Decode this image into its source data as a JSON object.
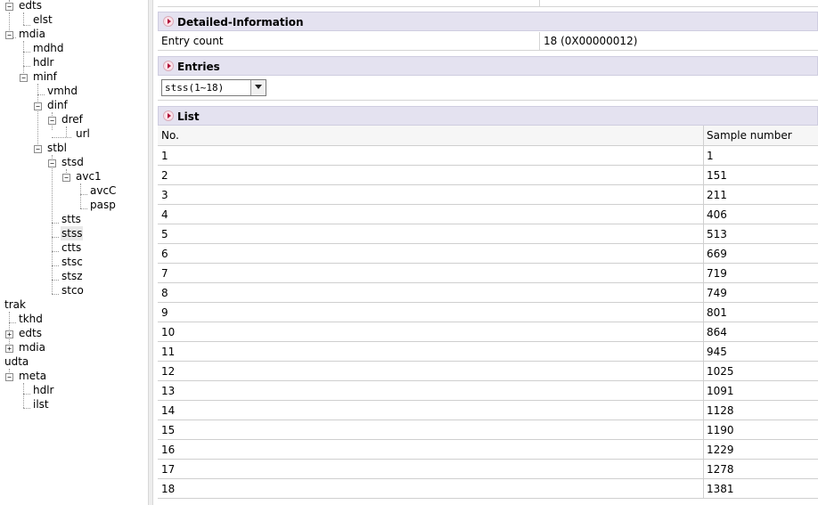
{
  "tree": {
    "nodes": [
      {
        "label": "edts"
      },
      {
        "label": "elst"
      },
      {
        "label": "mdia"
      },
      {
        "label": "mdhd"
      },
      {
        "label": "hdlr"
      },
      {
        "label": "minf"
      },
      {
        "label": "vmhd"
      },
      {
        "label": "dinf"
      },
      {
        "label": "dref"
      },
      {
        "label": "url"
      },
      {
        "label": "stbl"
      },
      {
        "label": "stsd"
      },
      {
        "label": "avc1"
      },
      {
        "label": "avcC"
      },
      {
        "label": "pasp"
      },
      {
        "label": "stts"
      },
      {
        "label": "stss"
      },
      {
        "label": "ctts"
      },
      {
        "label": "stsc"
      },
      {
        "label": "stsz"
      },
      {
        "label": "stco"
      },
      {
        "label": "trak"
      },
      {
        "label": "tkhd"
      },
      {
        "label": "edts"
      },
      {
        "label": "mdia"
      },
      {
        "label": "udta"
      },
      {
        "label": "meta"
      },
      {
        "label": "hdlr"
      },
      {
        "label": "ilst"
      }
    ],
    "expand_symbol": "+",
    "collapse_symbol": "−",
    "selected": "stss"
  },
  "panel": {
    "detailed_title": "Detailed-Information",
    "entry_count_label": "Entry count",
    "entry_count_value": "18 (0X00000012)",
    "entries_title": "Entries",
    "entries_select_value": "stss(1~18)",
    "list_title": "List",
    "list_headers": [
      "No.",
      "Sample number"
    ],
    "list_rows": [
      [
        "1",
        "1"
      ],
      [
        "2",
        "151"
      ],
      [
        "3",
        "211"
      ],
      [
        "4",
        "406"
      ],
      [
        "5",
        "513"
      ],
      [
        "6",
        "669"
      ],
      [
        "7",
        "719"
      ],
      [
        "8",
        "749"
      ],
      [
        "9",
        "801"
      ],
      [
        "10",
        "864"
      ],
      [
        "11",
        "945"
      ],
      [
        "12",
        "1025"
      ],
      [
        "13",
        "1091"
      ],
      [
        "14",
        "1128"
      ],
      [
        "15",
        "1190"
      ],
      [
        "16",
        "1229"
      ],
      [
        "17",
        "1278"
      ],
      [
        "18",
        "1381"
      ]
    ]
  },
  "colors": {
    "section_header_bg": "#e4e2f0",
    "section_arrow": "#b0123a",
    "selected_node_bg": "#e8e8e8"
  }
}
